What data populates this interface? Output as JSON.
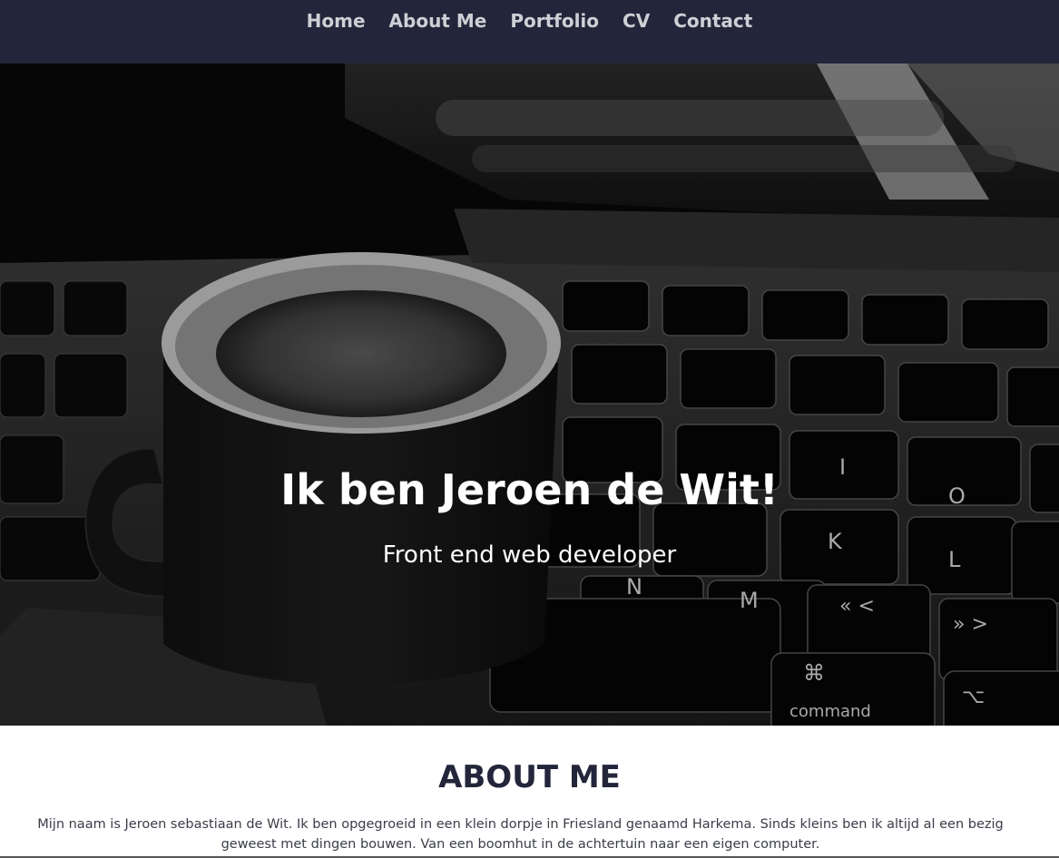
{
  "nav": {
    "items": [
      {
        "label": "Home"
      },
      {
        "label": "About Me"
      },
      {
        "label": "Portfolio"
      },
      {
        "label": "CV"
      },
      {
        "label": "Contact"
      }
    ]
  },
  "hero": {
    "title": "Ik ben Jeroen de Wit!",
    "subtitle": "Front end web developer",
    "keycaps": {
      "k": "K",
      "l": "L",
      "n": "N",
      "m": "M",
      "o": "O",
      "i": "I",
      "comma": "« <",
      "period": "» >",
      "cmd_symbol": "⌘",
      "cmd_label": "command",
      "opt_symbol": "⌥"
    }
  },
  "about": {
    "heading": "ABOUT ME",
    "text": "Mijn naam is Jeroen sebastiaan de Wit. Ik ben opgegroeid in een klein dorpje in Friesland genaamd Harkema. Sinds kleins ben ik altijd al een bezig geweest met dingen bouwen. Van een boomhut in de achtertuin naar een eigen computer."
  },
  "colors": {
    "navbar_bg": "#23263a",
    "nav_text": "#cfd0d6",
    "heading": "#23263a",
    "body_text": "#3a3d48"
  }
}
